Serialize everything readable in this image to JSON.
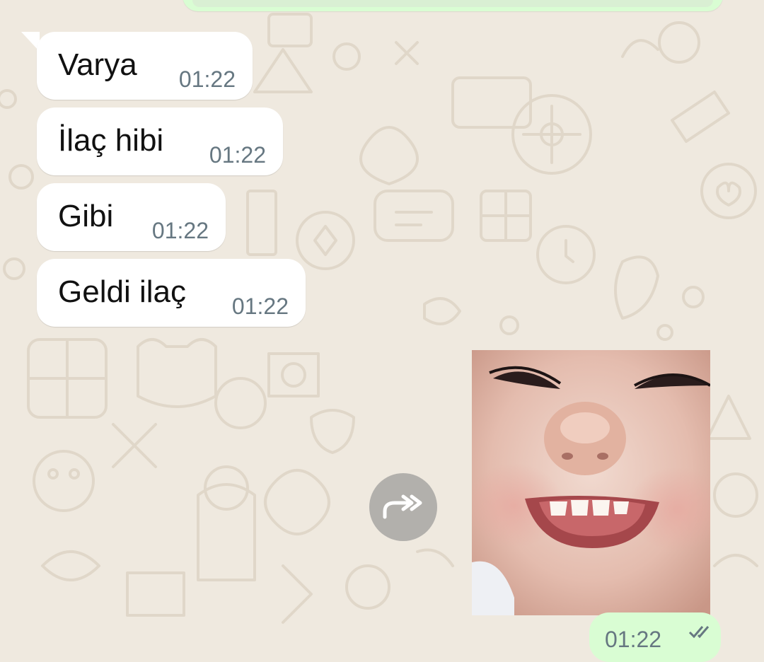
{
  "messages": [
    {
      "text": "Varya",
      "time": "01:22"
    },
    {
      "text": "İlaç hibi",
      "time": "01:22"
    },
    {
      "text": "Gibi",
      "time": "01:22"
    },
    {
      "text": "Geldi ilaç",
      "time": "01:22"
    }
  ],
  "bottom_outgoing": {
    "time": "01:22"
  },
  "colors": {
    "background": "#efe9df",
    "incoming_bubble": "#ffffff",
    "outgoing_bubble": "#d9fdd3",
    "time_text": "#667781"
  },
  "icons": {
    "forward": "forward-arrow-icon",
    "ticks": "double-check-icon"
  }
}
